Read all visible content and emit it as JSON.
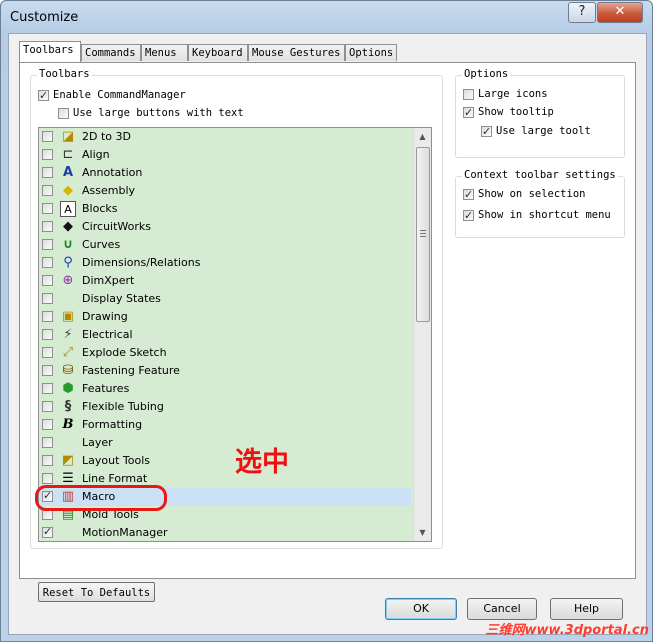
{
  "window": {
    "title": "Customize",
    "help_label": "?",
    "close_label": "✕"
  },
  "tabs": [
    {
      "label": "Toolbars",
      "active": true
    },
    {
      "label": "Commands"
    },
    {
      "label": "Menus"
    },
    {
      "label": "Keyboard"
    },
    {
      "label": "Mouse Gestures"
    },
    {
      "label": "Options"
    }
  ],
  "toolbars_group": {
    "legend": "Toolbars",
    "enable_commandmanager": {
      "label": "Enable CommandManager",
      "checked": true
    },
    "large_buttons_text": {
      "label": "Use large buttons with text",
      "checked": false
    },
    "items": [
      {
        "label": "2D to 3D",
        "checked": false,
        "icon": "2d-to-3d-icon"
      },
      {
        "label": "Align",
        "checked": false,
        "icon": "align-icon"
      },
      {
        "label": "Annotation",
        "checked": false,
        "icon": "annotation-icon"
      },
      {
        "label": "Assembly",
        "checked": false,
        "icon": "assembly-icon"
      },
      {
        "label": "Blocks",
        "checked": false,
        "icon": "blocks-icon"
      },
      {
        "label": "CircuitWorks",
        "checked": false,
        "icon": "circuitworks-icon"
      },
      {
        "label": "Curves",
        "checked": false,
        "icon": "curves-icon"
      },
      {
        "label": "Dimensions/Relations",
        "checked": false,
        "icon": "dimensions-icon"
      },
      {
        "label": "DimXpert",
        "checked": false,
        "icon": "dimxpert-icon"
      },
      {
        "label": "Display States",
        "checked": false,
        "icon": ""
      },
      {
        "label": "Drawing",
        "checked": false,
        "icon": "drawing-icon"
      },
      {
        "label": "Electrical",
        "checked": false,
        "icon": "electrical-icon"
      },
      {
        "label": "Explode Sketch",
        "checked": false,
        "icon": "explode-sketch-icon"
      },
      {
        "label": "Fastening Feature",
        "checked": false,
        "icon": "fastening-feature-icon"
      },
      {
        "label": "Features",
        "checked": false,
        "icon": "features-icon"
      },
      {
        "label": "Flexible Tubing",
        "checked": false,
        "icon": "flexible-tubing-icon"
      },
      {
        "label": "Formatting",
        "checked": false,
        "icon": "formatting-icon"
      },
      {
        "label": "Layer",
        "checked": false,
        "icon": ""
      },
      {
        "label": "Layout Tools",
        "checked": false,
        "icon": "layout-tools-icon"
      },
      {
        "label": "Line Format",
        "checked": false,
        "icon": "line-format-icon"
      },
      {
        "label": "Macro",
        "checked": true,
        "selected": true,
        "icon": "macro-icon"
      },
      {
        "label": "Mold Tools",
        "checked": false,
        "icon": "mold-tools-icon"
      },
      {
        "label": "MotionManager",
        "checked": true,
        "icon": ""
      }
    ],
    "reset_label": "Reset To Defaults"
  },
  "options_group": {
    "legend": "Options",
    "large_icons": {
      "label": "Large icons",
      "checked": false
    },
    "show_tooltip": {
      "label": "Show tooltip",
      "checked": true
    },
    "use_large_tooltips": {
      "label": "Use large toolt",
      "checked": true
    }
  },
  "context_group": {
    "legend": "Context toolbar settings",
    "show_on_selection": {
      "label": "Show on selection",
      "checked": true
    },
    "show_in_shortcut_menu": {
      "label": "Show in shortcut menu",
      "checked": true
    }
  },
  "buttons": {
    "ok": "OK",
    "cancel": "Cancel",
    "help": "Help"
  },
  "annotation": {
    "text": "选中",
    "color": "#ee1111"
  },
  "watermark": {
    "text": "三维网www.3dportal.cn"
  },
  "colors": {
    "list_bg": "#d6ecd2",
    "selected_row": "#cde1f6",
    "annotation_red": "#e81818"
  }
}
